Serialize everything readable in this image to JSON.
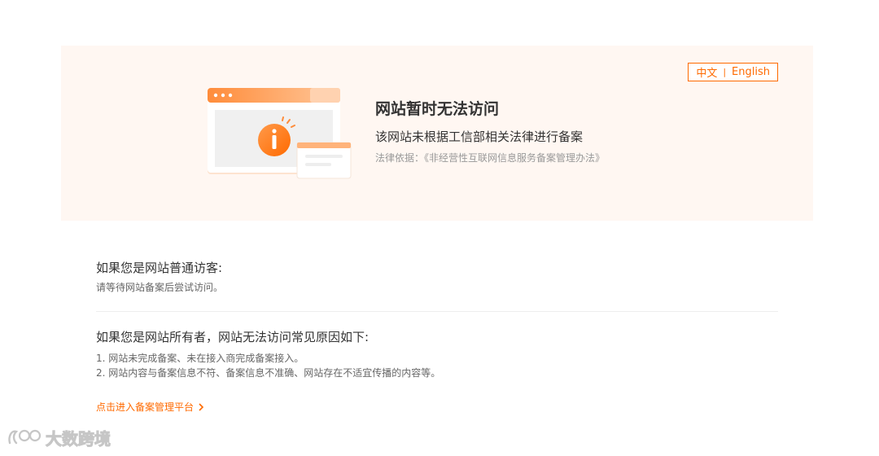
{
  "banner": {
    "lang": {
      "zh": "中文",
      "separator": "|",
      "en": "English"
    },
    "title": "网站暂时无法访问",
    "subtitle": "该网站未根据工信部相关法律进行备案",
    "law_basis": "法律依据：《非经营性互联网信息服务备案管理办法》"
  },
  "visitor": {
    "title": "如果您是网站普通访客:",
    "text": "请等待网站备案后尝试访问。"
  },
  "owner": {
    "title": "如果您是网站所有者，网站无法访问常见原因如下:",
    "reasons": [
      "1. 网站未完成备案、未在接入商完成备案接入。",
      "2. 网站内容与备案信息不符、备案信息不准确、网站存在不适宜传播的内容等。"
    ]
  },
  "link": {
    "label": "点击进入备案管理平台"
  },
  "watermark": {
    "text": "大数跨境",
    "icon": "logo-icon"
  },
  "colors": {
    "accent": "#ff6a00",
    "banner_bg": "#fff7f2",
    "title_text": "#333333",
    "muted_text": "#999999",
    "body_text": "#666666"
  }
}
